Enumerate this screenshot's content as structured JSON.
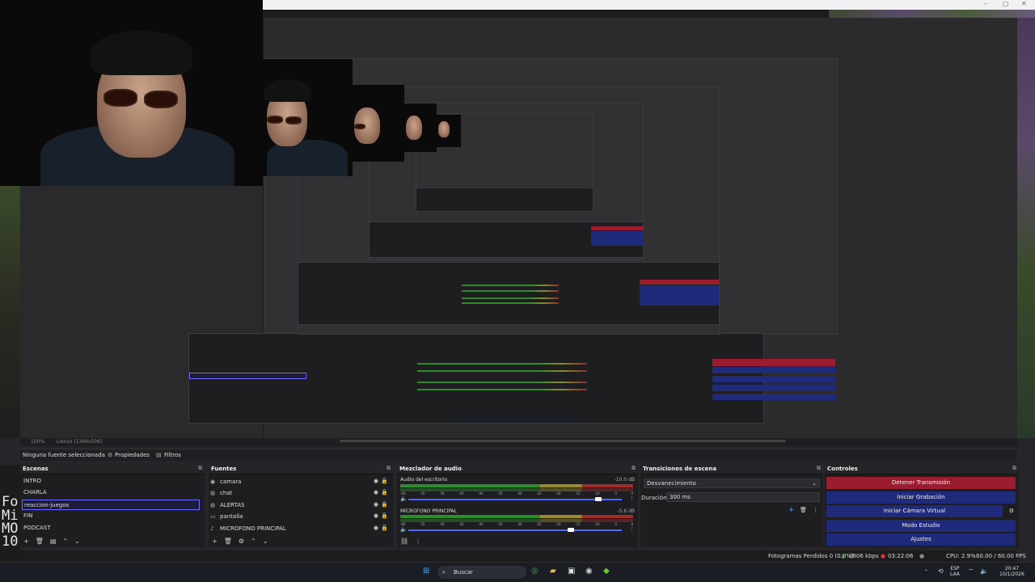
{
  "browser": {
    "controls": [
      "–",
      "▢",
      "✕"
    ]
  },
  "zoombar": {
    "zoom": "100%",
    "canvas": "Lienzo (1364x506)"
  },
  "selection": {
    "no_source": "Ninguna fuente seleccionada",
    "properties": "Propiedades",
    "filters": "Filtros"
  },
  "scenes": {
    "title": "Escenas",
    "items": [
      "INTRO",
      "CHARLA",
      "reaccion-juegos",
      "FIN",
      "PODCAST"
    ],
    "selected": "reaccion-juegos"
  },
  "sources": {
    "title": "Fuentes",
    "items": [
      {
        "icon": "camera-icon",
        "glyph": "◉",
        "label": "camara"
      },
      {
        "icon": "browser-icon",
        "glyph": "◍",
        "label": "chat"
      },
      {
        "icon": "browser-icon",
        "glyph": "◍",
        "label": "ALERTAS"
      },
      {
        "icon": "display-icon",
        "glyph": "▭",
        "label": "pantalla"
      },
      {
        "icon": "mic-icon",
        "glyph": "♪",
        "label": "MICROFONO PRINCIPAL"
      }
    ]
  },
  "mixer": {
    "title": "Mezclador de audio",
    "channels": [
      {
        "name": "Audio del escritorio",
        "db": "-10.0 dB",
        "volume": 0.89
      },
      {
        "name": "MICROFONO PRINCIPAL",
        "db": "-5.6 dB",
        "volume": 0.76
      }
    ],
    "scale": [
      "-60",
      "-55",
      "-50",
      "-45",
      "-40",
      "-35",
      "-30",
      "-25",
      "-20",
      "-15",
      "-10",
      "-5",
      "0"
    ]
  },
  "transitions": {
    "title": "Transiciones de escena",
    "selected": "Desvanecimiento",
    "duration_label": "Duración",
    "duration_value": "300 ms"
  },
  "controls": {
    "title": "Controles",
    "buttons": [
      {
        "label": "Detener Transmisión",
        "style": "red"
      },
      {
        "label": "Iniciar Grabación",
        "style": "blue"
      },
      {
        "label": "Iniciar Cámara Virtual",
        "style": "blue"
      },
      {
        "label": "Modo Estudio",
        "style": "blue"
      },
      {
        "label": "Ajustes",
        "style": "blue"
      }
    ]
  },
  "status": {
    "dropped": "Fotogramas Perdidos 0 (0.0%)",
    "bitrate": "2806 kbps",
    "time": "03:22:06",
    "cpu": "CPU: 2.9%",
    "fps": "60.00 / 60.00 FPS"
  },
  "taskbar": {
    "search": "Buscar",
    "lang": "ESP",
    "lang2": "LAA",
    "clock": "20:47",
    "date": "10/1/2026"
  },
  "minecraft": {
    "lines": [
      "Fo",
      "Mi",
      "MO",
      "10"
    ]
  }
}
